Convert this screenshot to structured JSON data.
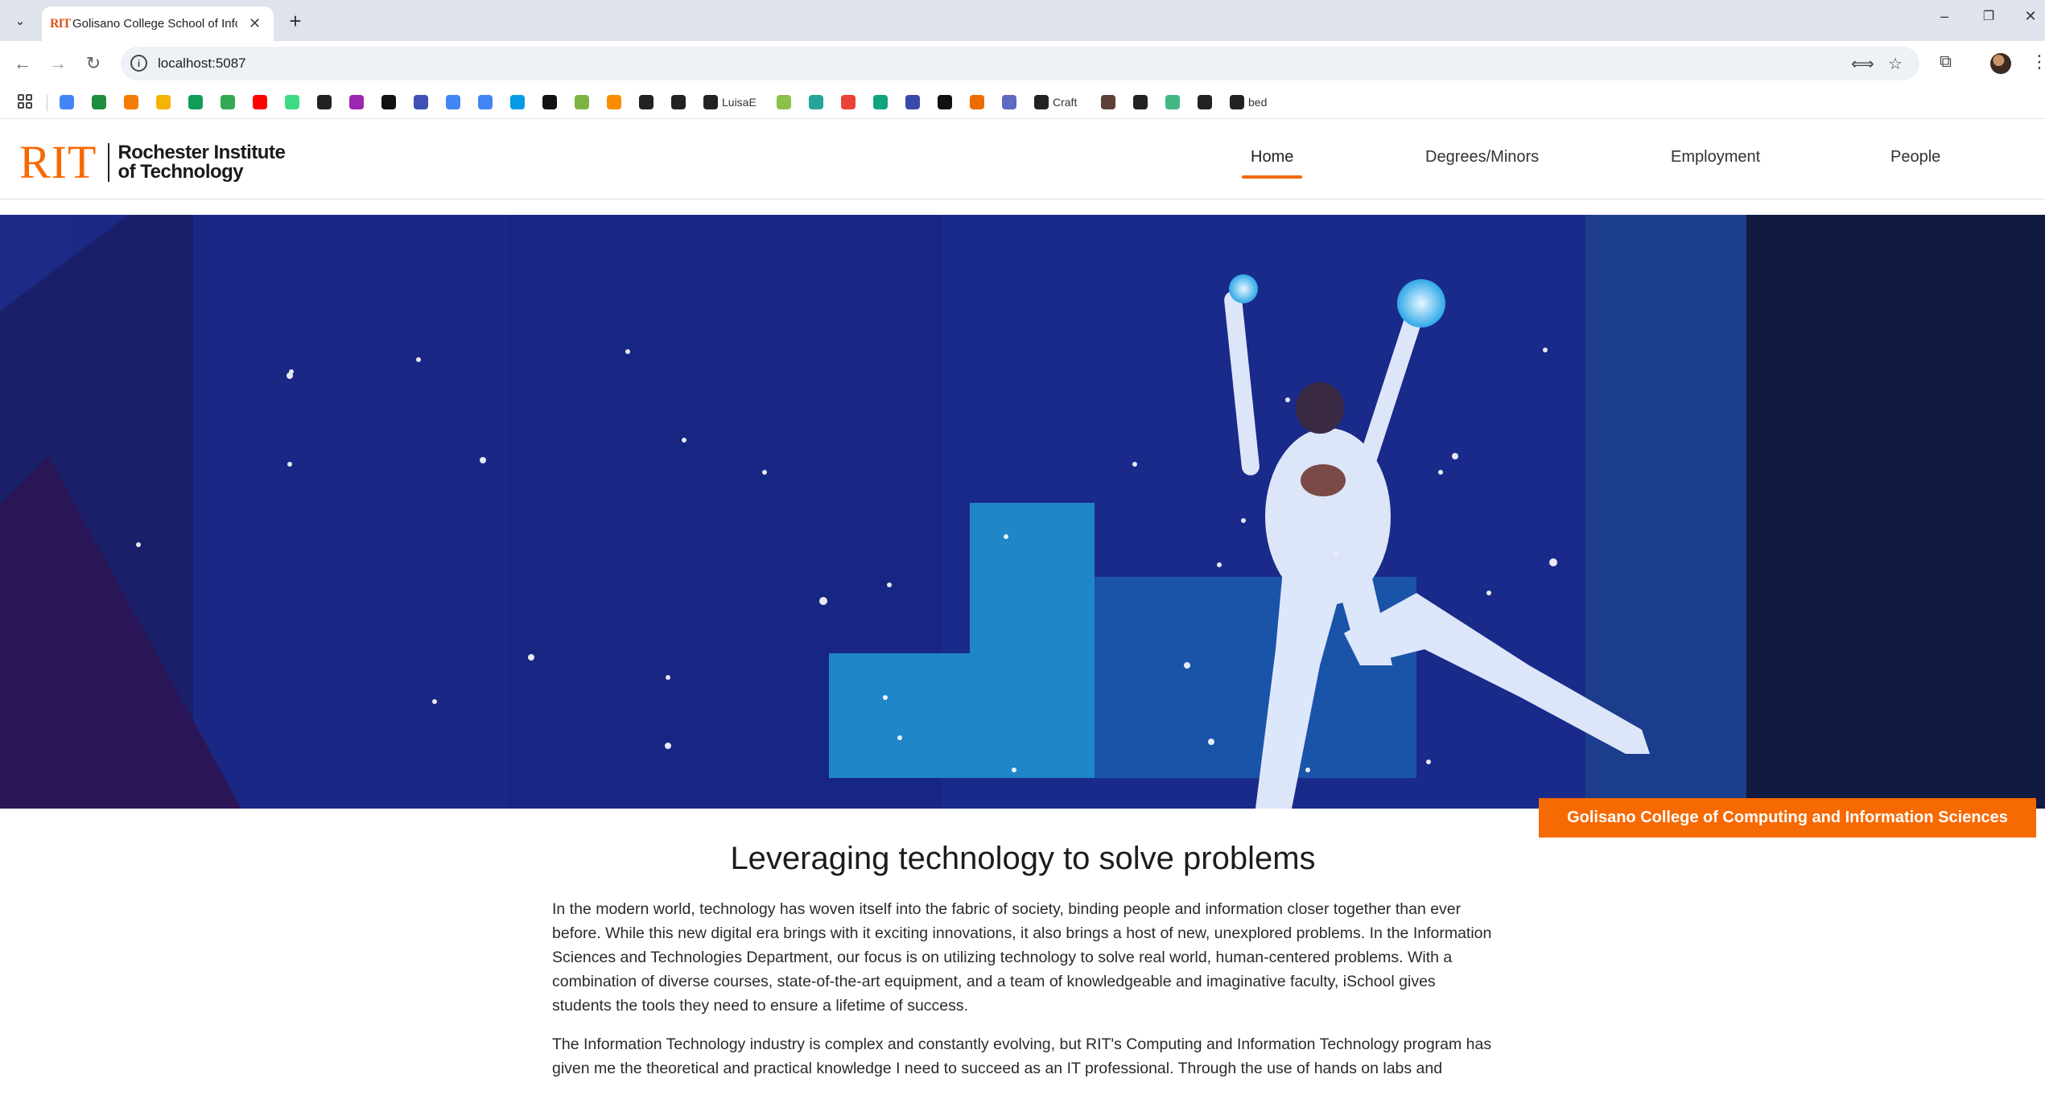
{
  "browser": {
    "tab": {
      "favicon_text": "RIT",
      "title": "Golisano College School of Information"
    },
    "url": "localhost:5087",
    "bookmarks": [
      {
        "label": "",
        "icon": "docs-icon",
        "color": "#4285f4"
      },
      {
        "label": "",
        "icon": "app-icon",
        "color": "#1e8e3e"
      },
      {
        "label": "",
        "icon": "gear-icon",
        "color": "#f57c00"
      },
      {
        "label": "",
        "icon": "slides-icon",
        "color": "#f4b400"
      },
      {
        "label": "",
        "icon": "sheets-icon",
        "color": "#0f9d58"
      },
      {
        "label": "",
        "icon": "drive-icon",
        "color": "#34a853"
      },
      {
        "label": "",
        "icon": "youtube-icon",
        "color": "#ff0000"
      },
      {
        "label": "",
        "icon": "android-icon",
        "color": "#3ddc84"
      },
      {
        "label": "",
        "icon": "github-icon",
        "color": "#222222"
      },
      {
        "label": "",
        "icon": "loop-icon",
        "color": "#9c27b0"
      },
      {
        "label": "",
        "icon": "openai-icon",
        "color": "#111111"
      },
      {
        "label": "",
        "icon": "cursor-icon",
        "color": "#3f51b5"
      },
      {
        "label": "",
        "icon": "sparkle-icon",
        "color": "#4285f4"
      },
      {
        "label": "",
        "icon": "translate-icon",
        "color": "#4285f4"
      },
      {
        "label": "",
        "icon": "calendar-icon",
        "color": "#039be5"
      },
      {
        "label": "",
        "icon": "pen-icon",
        "color": "#111111"
      },
      {
        "label": "",
        "icon": "spiral-icon",
        "color": "#7cb342"
      },
      {
        "label": "",
        "icon": "sun-icon",
        "color": "#fb8c00"
      },
      {
        "label": "",
        "icon": "notebook-icon",
        "color": "#222222"
      },
      {
        "label": "",
        "icon": "stack-icon",
        "color": "#222222"
      },
      {
        "label": "LuisaE",
        "icon": "github-icon",
        "color": "#222222"
      },
      {
        "label": "",
        "icon": "image-icon",
        "color": "#8bc34a"
      },
      {
        "label": "",
        "icon": "refresh-icon",
        "color": "#26a69a"
      },
      {
        "label": "",
        "icon": "gmail-icon",
        "color": "#ea4335"
      },
      {
        "label": "",
        "icon": "chat-icon",
        "color": "#10a37f"
      },
      {
        "label": "",
        "icon": "tools-icon",
        "color": "#3949ab"
      },
      {
        "label": "",
        "icon": "m-icon",
        "color": "#111111"
      },
      {
        "label": "",
        "icon": "api-icon",
        "color": "#ef6c00"
      },
      {
        "label": "",
        "icon": "shield-icon",
        "color": "#5c6bc0"
      },
      {
        "label": "Craft",
        "icon": "github-icon",
        "color": "#222222"
      },
      {
        "label": "",
        "icon": "crest-icon",
        "color": "#5d4037"
      },
      {
        "label": "",
        "icon": "globe-icon",
        "color": "#222222"
      },
      {
        "label": "",
        "icon": "vue-icon",
        "color": "#41b883"
      },
      {
        "label": "",
        "icon": "cube-icon",
        "color": "#222222"
      },
      {
        "label": "bed",
        "icon": "github-icon",
        "color": "#222222"
      }
    ]
  },
  "site": {
    "logo": {
      "mark": "RIT",
      "line1": "Rochester Institute",
      "line2": "of Technology"
    },
    "nav": [
      {
        "label": "Home",
        "active": true
      },
      {
        "label": "Degrees/Minors",
        "active": false
      },
      {
        "label": "Employment",
        "active": false
      },
      {
        "label": "People",
        "active": false
      }
    ],
    "hero_badge": "Golisano College of Computing and Information Sciences",
    "heading": "Leveraging technology to solve problems",
    "paragraphs": [
      "In the modern world, technology has woven itself into the fabric of society, binding people and information closer together than ever before. While this new digital era brings with it exciting innovations, it also brings a host of new, unexplored problems. In the Information Sciences and Technologies Department, our focus is on utilizing technology to solve real world, human-centered problems. With a combination of diverse courses, state-of-the-art equipment, and a team of knowledgeable and imaginative faculty, iSchool gives students the tools they need to ensure a lifetime of success.",
      "The Information Technology industry is complex and constantly evolving, but RIT's Computing and Information Technology program has given me the theoretical and practical knowledge I need to succeed as an IT professional. Through the use of hands on labs and"
    ],
    "colors": {
      "accent": "#f76902"
    }
  }
}
